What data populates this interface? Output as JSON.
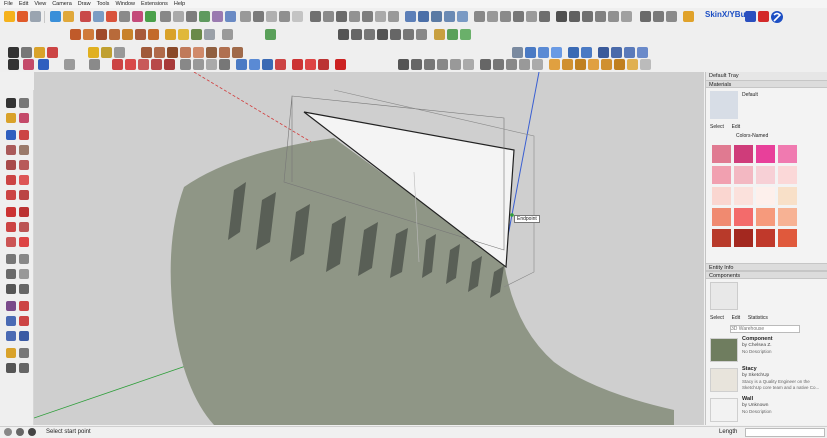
{
  "menu": [
    "File",
    "Edit",
    "View",
    "Camera",
    "Draw",
    "Tools",
    "Window",
    "Extensions",
    "Help"
  ],
  "toolbar": {
    "skin_label": "SkinX/YBub"
  },
  "viewport": {
    "tooltip": "Endpoint"
  },
  "tray": {
    "title": "Default Tray",
    "materials": {
      "header": "Materials",
      "current_name": "Default",
      "tabs": [
        "Select",
        "Edit"
      ],
      "collection": "Colors-Named",
      "swatches": [
        "#e07a91",
        "#cf3c7a",
        "#e8409a",
        "#f07ab0",
        "#f1a0b0",
        "#f3b8c2",
        "#f7d0d6",
        "#fbd8d8",
        "#fad6d0",
        "#fbe1dc",
        "#fdf0ec",
        "#f8e0c8",
        "#f08a70",
        "#f36b6b",
        "#f69a7c",
        "#f7b294",
        "#b83a2a",
        "#a3281f",
        "#c0392b",
        "#e0593c"
      ]
    },
    "entity_info": {
      "header": "Entity Info"
    },
    "components": {
      "header": "Components",
      "tabs": [
        "Select",
        "Edit",
        "Statistics"
      ],
      "search_placeholder": "3D Warehouse",
      "items": [
        {
          "name": "Component",
          "author": "by Chelsea Z.",
          "description": "No Description"
        },
        {
          "name": "Stacy",
          "author": "by SketchUp",
          "description": "Stacy is a Quality Engineer on the SketchUp core team and a native Co..."
        },
        {
          "name": "Wall",
          "author": "by Unknown",
          "description": "No Description"
        }
      ]
    }
  },
  "status": {
    "text": "Select start point",
    "length_label": "Length",
    "length_value": ""
  },
  "colors": {
    "sky": "#cfcfcf",
    "ground": "#c4c4c4",
    "stair_top": "#8e9585",
    "stair_riser": "#595f56",
    "wall_face": "#f4f4f4",
    "axis_red": "#d23a3a",
    "axis_green": "#2e9e3a",
    "axis_blue": "#3a5fd2",
    "accent_blue": "#1d4fc4"
  }
}
